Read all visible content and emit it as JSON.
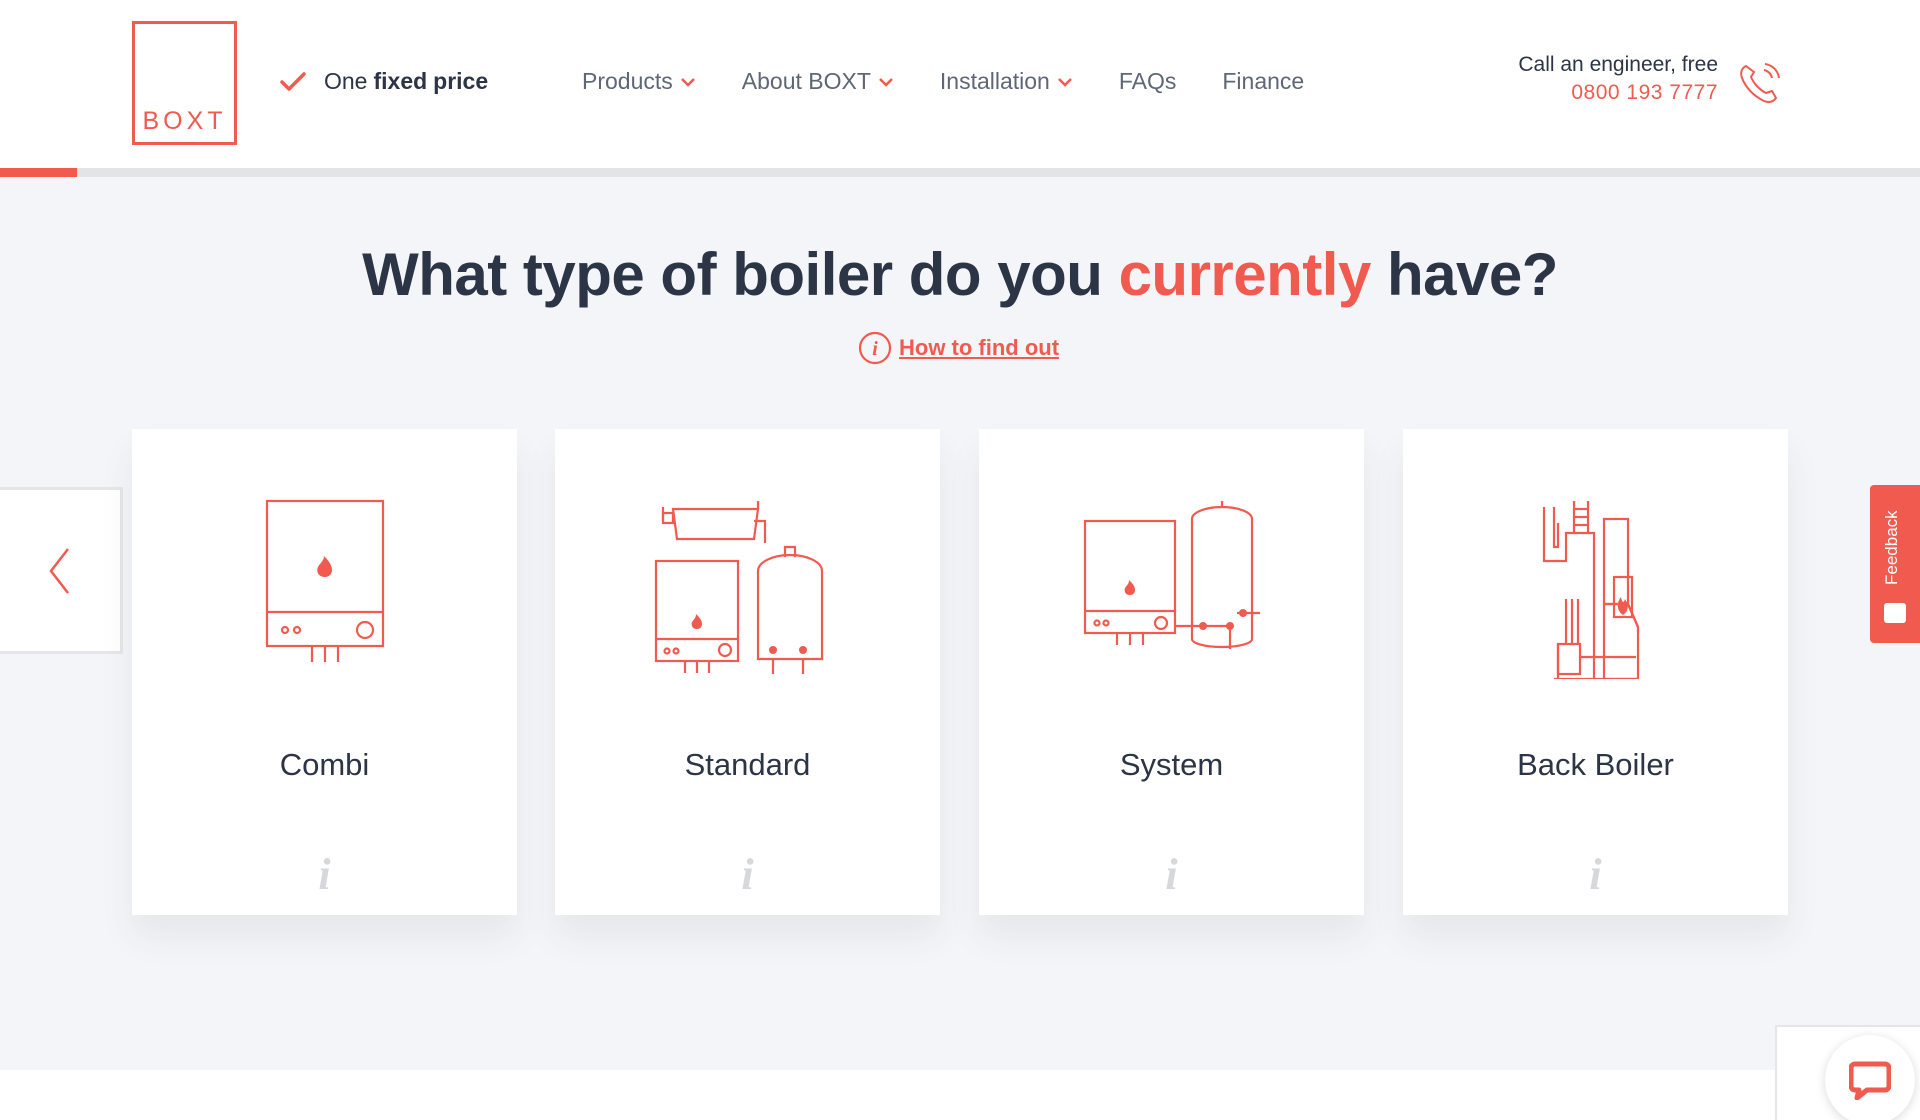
{
  "header": {
    "logo_text": "BOXT",
    "fixed_price": {
      "pre": "One",
      "bold": "fixed",
      "post": "price"
    },
    "nav": [
      {
        "label": "Products",
        "has_dropdown": true
      },
      {
        "label": "About BOXT",
        "has_dropdown": true
      },
      {
        "label": "Installation",
        "has_dropdown": true
      },
      {
        "label": "FAQs",
        "has_dropdown": false
      },
      {
        "label": "Finance",
        "has_dropdown": false
      }
    ],
    "call_label": "Call an engineer, free",
    "call_number": "0800 193 7777"
  },
  "progress": {
    "fraction": 0.04
  },
  "main": {
    "heading_pre": "What type of boiler do you",
    "heading_accent": "currently",
    "heading_post": "have?",
    "find_out_link": "How to find out",
    "cards": [
      {
        "label": "Combi",
        "icon": "combi-boiler-icon",
        "info": "i"
      },
      {
        "label": "Standard",
        "icon": "standard-boiler-icon",
        "info": "i"
      },
      {
        "label": "System",
        "icon": "system-boiler-icon",
        "info": "i"
      },
      {
        "label": "Back Boiler",
        "icon": "back-boiler-icon",
        "info": "i"
      }
    ]
  },
  "feedback_label": "Feedback",
  "colors": {
    "accent": "#f05a4f",
    "text": "#2b3545",
    "muted": "#5e6776",
    "background": "#f4f5f8"
  }
}
